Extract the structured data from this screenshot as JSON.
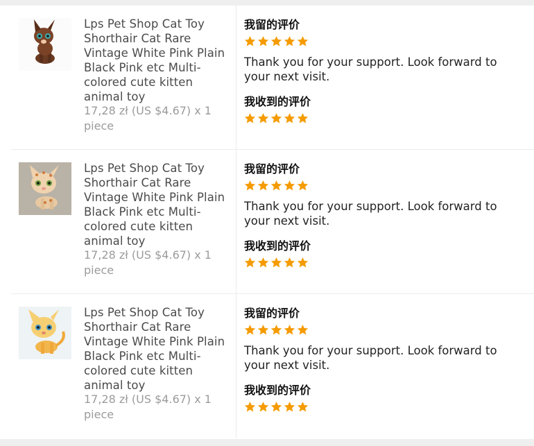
{
  "colors": {
    "star": "#f59b00",
    "divider": "#ececec"
  },
  "items": [
    {
      "image_icon": "brown-dog-toy-image",
      "title": "Lps Pet Shop Cat Toy Shorthair Cat Rare Vintage White Pink Plain Black Pink etc Multi-colored cute kitten animal toy",
      "price": "17,28 zł (US $4.67) x 1 piece",
      "my_review_label": "我留的评价",
      "my_rating": 5,
      "my_review_text": "Thank you for your support. Look forward to your next visit.",
      "received_review_label": "我收到的评价",
      "received_rating": 5
    },
    {
      "image_icon": "spotted-cat-toy-image",
      "title": "Lps Pet Shop Cat Toy Shorthair Cat Rare Vintage White Pink Plain Black Pink etc Multi-colored cute kitten animal toy",
      "price": "17,28 zł (US $4.67) x 1 piece",
      "my_review_label": "我留的评价",
      "my_rating": 5,
      "my_review_text": "Thank you for your support. Look forward to your next visit.",
      "received_review_label": "我收到的评价",
      "received_rating": 5
    },
    {
      "image_icon": "yellow-cat-toy-image",
      "title": "Lps Pet Shop Cat Toy Shorthair Cat Rare Vintage White Pink Plain Black Pink etc Multi-colored cute kitten animal toy",
      "price": "17,28 zł (US $4.67) x 1 piece",
      "my_review_label": "我留的评价",
      "my_rating": 5,
      "my_review_text": "Thank you for your support. Look forward to your next visit.",
      "received_review_label": "我收到的评价",
      "received_rating": 5
    }
  ]
}
